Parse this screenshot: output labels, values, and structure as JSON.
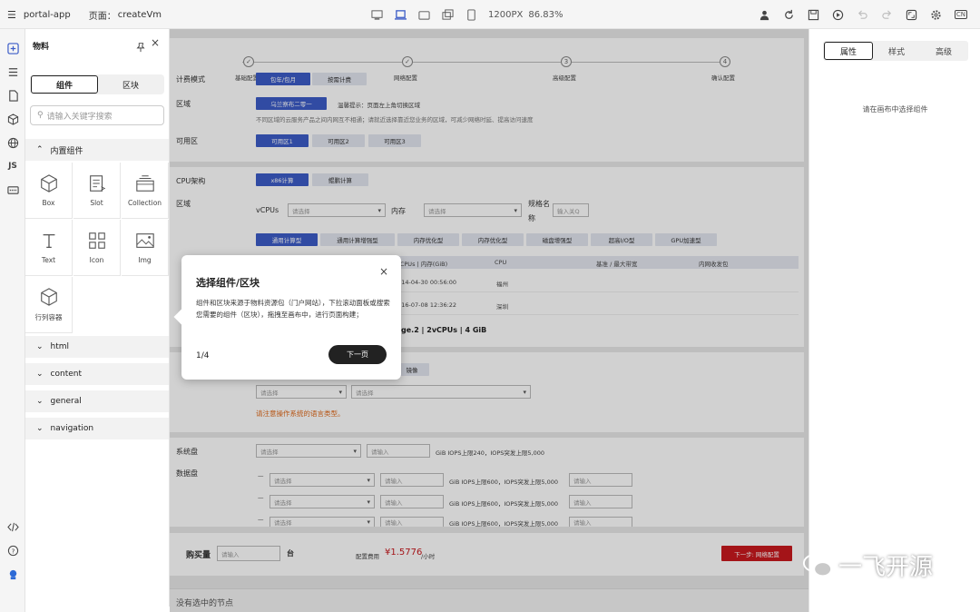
{
  "topbar": {
    "app": "portal-app",
    "page_label": "页面：",
    "page_name": "createVm",
    "size_label": "1200PX",
    "zoom": "86.83%",
    "lang": "CN"
  },
  "iconbar": {
    "js": "JS"
  },
  "panel": {
    "title": "物料",
    "tabs": [
      "组件",
      "区块"
    ],
    "search_placeholder": "请输入关键字搜索",
    "group_builtin": "内置组件",
    "components": [
      "Box",
      "Slot",
      "Collection",
      "Text",
      "Icon",
      "Img",
      "行列容器"
    ],
    "groups": [
      "html",
      "content",
      "general",
      "navigation"
    ]
  },
  "canvas": {
    "steps": [
      "基础配置",
      "网络配置",
      "高级配置",
      "确认配置"
    ],
    "step_nums": [
      "3",
      "4"
    ],
    "billing_label": "计费模式",
    "billing_opts": [
      "包年/包月",
      "按需计费"
    ],
    "region_label": "区域",
    "region_btn": "乌兰察布二零一",
    "region_tip": "温馨提示：页面左上角切换区域",
    "region_note": "不同区域的云服务产品之间内网互不相通；请就近选择靠近您业务的区域，可减少网络时延、提高访问速度",
    "az_label": "可用区",
    "az_opts": [
      "可用区1",
      "可用区2",
      "可用区3"
    ],
    "cpu_label": "CPU架构",
    "cpu_opts": [
      "x86计算",
      "鲲鹏计算"
    ],
    "region2_label": "区域",
    "vcpu_label": "vCPUs",
    "vcpu_ph": "请选择",
    "mem_label": "内存",
    "mem_ph": "请选择",
    "spec_label": "规格名",
    "spec_label2": "称",
    "spec_ph": "输入关Q",
    "types": [
      "通用计算型",
      "通用计算增强型",
      "内存优化型",
      "内存优化型",
      "磁盘增强型",
      "超高I/O型",
      "GPU加速型"
    ],
    "table_headers": [
      "vCPUs | 内存(GiB)",
      "CPU",
      "基准 / 最大带宽",
      "内网收发包"
    ],
    "rows": [
      [
        "2014-04-30 00:56:00",
        "福州"
      ],
      [
        "2016-07-08 12:36:22",
        "深圳"
      ]
    ],
    "selected_spec": "ge.2 | 2vCPUs | 4 GiB",
    "image_btn": "镜像",
    "os_sel1": "请选择",
    "os_sel2": "请选择",
    "os_warning": "请注意操作系统的语言类型。",
    "sysdisk_label": "系统盘",
    "sysdisk_sel": "请选择",
    "sysdisk_input": "请输入",
    "sysdisk_info": "GiB IOPS上限240，IOPS突发上限5,000",
    "datadisk_label": "数据盘",
    "disk_rows": [
      {
        "sel": "请选择",
        "input": "请输入",
        "info": "GiB IOPS上限600，IOPS突发上限5,000",
        "input2": "请输入"
      },
      {
        "sel": "请选择",
        "input": "请输入",
        "info": "GiB IOPS上限600，IOPS突发上限5,000",
        "input2": "请输入"
      },
      {
        "sel": "请选择",
        "input": "请输入",
        "info": "GiB IOPS上限600，IOPS突发上限5,000",
        "input2": "请输入"
      }
    ],
    "qty_label": "购买量",
    "qty_ph": "请输入",
    "qty_unit": "台",
    "fee_label": "配置费用",
    "fee_value": "¥1.5776",
    "fee_unit": "/小时",
    "next_btn": "下一步: 网络配置",
    "footer": "没有选中的节点"
  },
  "right": {
    "tabs": [
      "属性",
      "样式",
      "高级"
    ],
    "hint": "请在画布中选择组件"
  },
  "popup": {
    "title": "选择组件/区块",
    "body": "组件和区块来源于物料资源包（门户网站），下拉滚动面板或搜索您需要的组件（区块），拖拽至画布中，进行页面构建；",
    "page": "1/4",
    "next": "下一页",
    "close": "×"
  },
  "watermark": "一飞开源",
  "colors": {
    "primary": "#3c5cc7",
    "danger": "#c8191e",
    "warn": "#e06a1c"
  }
}
